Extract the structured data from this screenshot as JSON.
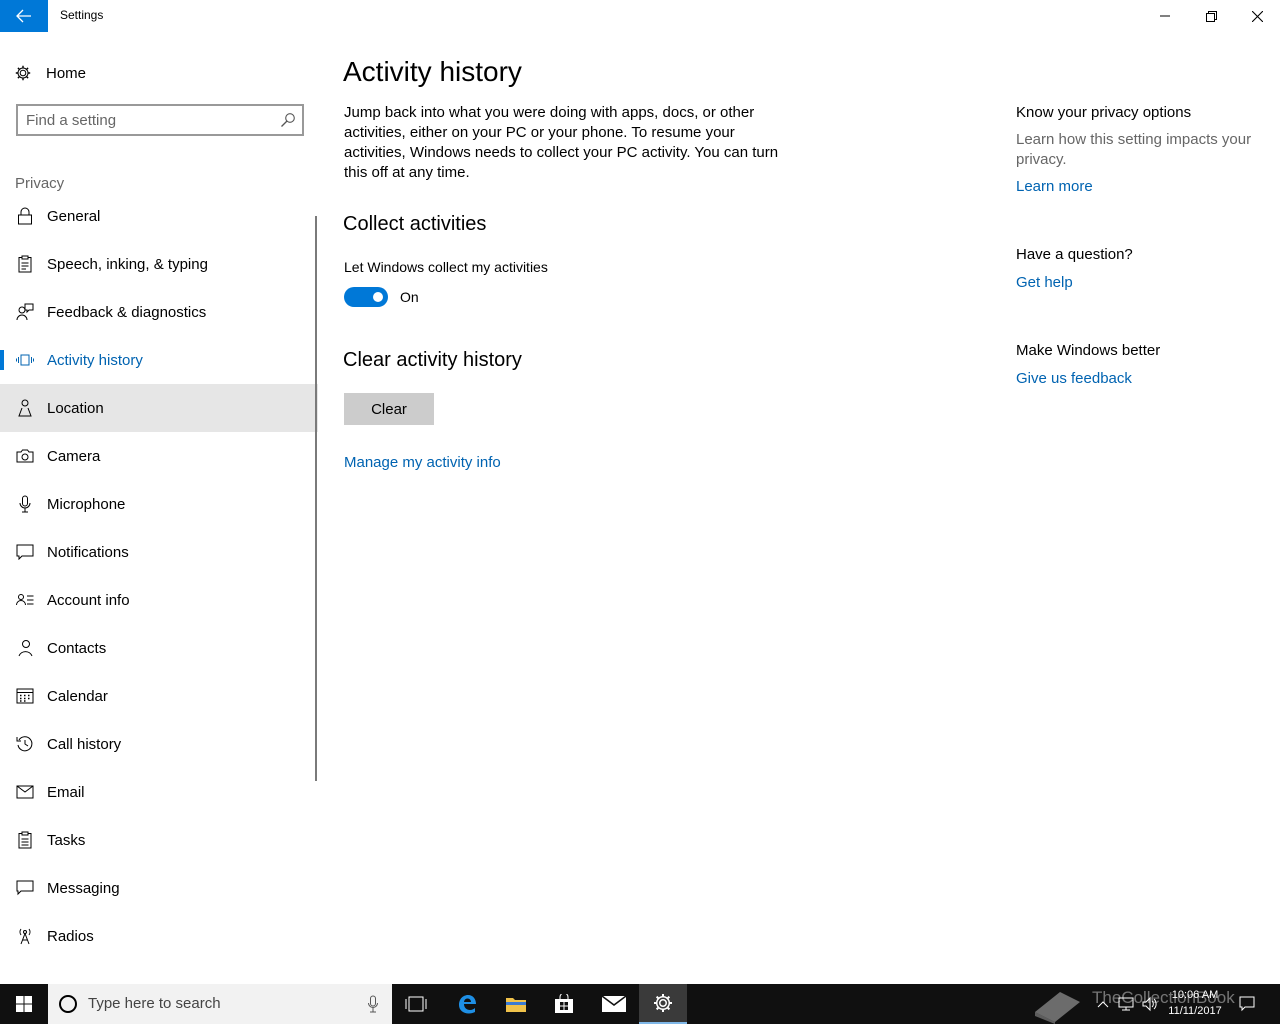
{
  "window": {
    "title": "Settings",
    "accent": "#0078d7"
  },
  "sidebar": {
    "home_label": "Home",
    "search_placeholder": "Find a setting",
    "section": "Privacy",
    "items": [
      {
        "label": "General",
        "icon": "lock-icon"
      },
      {
        "label": "Speech, inking, & typing",
        "icon": "clipboard-icon"
      },
      {
        "label": "Feedback & diagnostics",
        "icon": "feedback-person-icon"
      },
      {
        "label": "Activity history",
        "icon": "activity-icon",
        "selected": true
      },
      {
        "label": "Location",
        "icon": "location-person-icon",
        "hover": true
      },
      {
        "label": "Camera",
        "icon": "camera-icon"
      },
      {
        "label": "Microphone",
        "icon": "microphone-icon"
      },
      {
        "label": "Notifications",
        "icon": "message-icon"
      },
      {
        "label": "Account info",
        "icon": "account-info-icon"
      },
      {
        "label": "Contacts",
        "icon": "contacts-icon"
      },
      {
        "label": "Calendar",
        "icon": "calendar-icon"
      },
      {
        "label": "Call history",
        "icon": "history-icon"
      },
      {
        "label": "Email",
        "icon": "mail-icon"
      },
      {
        "label": "Tasks",
        "icon": "tasks-icon"
      },
      {
        "label": "Messaging",
        "icon": "chat-icon"
      },
      {
        "label": "Radios",
        "icon": "radio-tower-icon"
      }
    ]
  },
  "main": {
    "title": "Activity history",
    "description": "Jump back into what you were doing with apps, docs, or other activities, either on your PC or your phone. To resume your activities, Windows needs to collect your PC activity. You can turn this off at any time.",
    "collect_heading": "Collect activities",
    "toggle_label": "Let Windows collect my activities",
    "toggle_state": "On",
    "clear_heading": "Clear activity history",
    "clear_button": "Clear",
    "manage_link": "Manage my activity info"
  },
  "right_panel": {
    "privacy_title": "Know your privacy options",
    "privacy_text": "Learn how this setting impacts your privacy.",
    "learn_more": "Learn more",
    "question_title": "Have a question?",
    "get_help": "Get help",
    "better_title": "Make Windows better",
    "feedback_link": "Give us feedback"
  },
  "taskbar": {
    "search_placeholder": "Type here to search",
    "time": "10:06 AM",
    "date": "11/11/2017",
    "watermark": "TheCollectionBook"
  }
}
